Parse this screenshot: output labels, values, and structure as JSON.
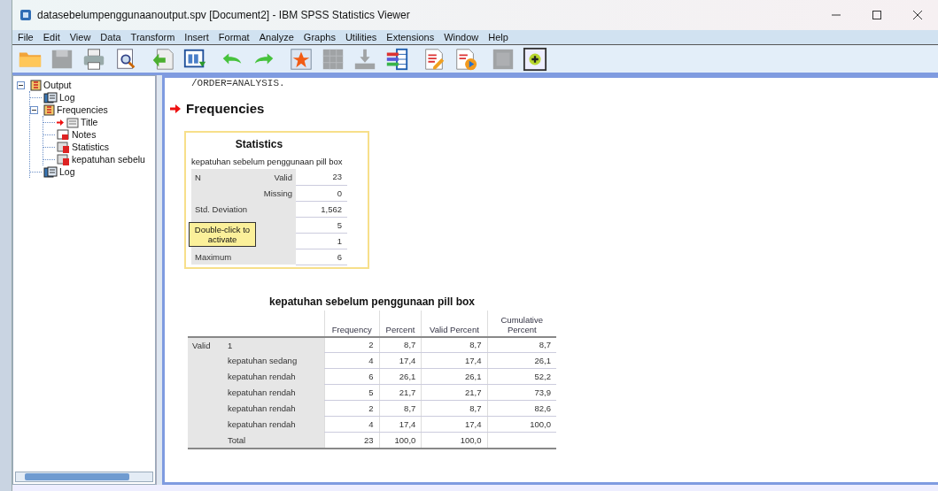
{
  "window": {
    "title": "datasebelumpenggunaanoutput.spv [Document2] - IBM SPSS Statistics Viewer"
  },
  "menu": [
    "File",
    "Edit",
    "View",
    "Data",
    "Transform",
    "Insert",
    "Format",
    "Analyze",
    "Graphs",
    "Utilities",
    "Extensions",
    "Window",
    "Help"
  ],
  "toolbar": [
    {
      "kind": "folder",
      "disabled": false
    },
    {
      "kind": "save",
      "disabled": true
    },
    {
      "kind": "print",
      "disabled": false
    },
    {
      "kind": "preview",
      "disabled": false
    },
    {
      "kind": "export",
      "disabled": false
    },
    {
      "kind": "dialog",
      "disabled": false
    },
    {
      "kind": "undo",
      "disabled": false
    },
    {
      "kind": "redo",
      "disabled": false
    },
    {
      "kind": "star",
      "disabled": false
    },
    {
      "kind": "grid",
      "disabled": true
    },
    {
      "kind": "download",
      "disabled": true
    },
    {
      "kind": "variables",
      "disabled": false
    },
    {
      "kind": "pencil",
      "disabled": false
    },
    {
      "kind": "play",
      "disabled": false
    },
    {
      "kind": "square",
      "disabled": true
    },
    {
      "kind": "plus",
      "disabled": false
    }
  ],
  "outline": [
    {
      "label": "Output",
      "kind": "book",
      "expanded": true,
      "current": false,
      "children": [
        {
          "label": "Log",
          "kind": "log",
          "current": false
        },
        {
          "label": "Frequencies",
          "kind": "book",
          "expanded": true,
          "current": false,
          "children": [
            {
              "label": "Title",
              "kind": "title",
              "current": true
            },
            {
              "label": "Notes",
              "kind": "notes",
              "current": false
            },
            {
              "label": "Statistics",
              "kind": "table",
              "current": false
            },
            {
              "label": "kepatuhan sebelu",
              "kind": "table",
              "current": false
            }
          ]
        },
        {
          "label": "Log",
          "kind": "log",
          "current": false
        }
      ]
    }
  ],
  "viewer": {
    "syntax_tail": "/ORDER=ANALYSIS.",
    "heading": "Frequencies",
    "statistics": {
      "selected": true,
      "title": "Statistics",
      "subtitle": "kepatuhan sebelum penggunaan pill box",
      "rows": [
        {
          "label": "N",
          "sublabel": "Valid",
          "value": "23"
        },
        {
          "label": "",
          "sublabel": "Missing",
          "value": "0"
        },
        {
          "label": "Std. Deviation",
          "sublabel": "",
          "value": "1,562"
        },
        {
          "label": "",
          "sublabel": "",
          "value": "5"
        },
        {
          "label": "",
          "sublabel": "",
          "value": "1"
        },
        {
          "label": "Maximum",
          "sublabel": "",
          "value": "6"
        }
      ],
      "tooltip": "Double-click to activate"
    },
    "frequency_table": {
      "title": "kepatuhan sebelum penggunaan pill box",
      "columns": [
        "Frequency",
        "Percent",
        "Valid Percent",
        "Cumulative Percent"
      ],
      "rows": [
        {
          "group": "Valid",
          "label": "1",
          "cells": [
            "2",
            "8,7",
            "8,7",
            "8,7"
          ]
        },
        {
          "group": "",
          "label": "kepatuhan sedang",
          "cells": [
            "4",
            "17,4",
            "17,4",
            "26,1"
          ]
        },
        {
          "group": "",
          "label": "kepatuhan rendah",
          "cells": [
            "6",
            "26,1",
            "26,1",
            "52,2"
          ]
        },
        {
          "group": "",
          "label": "kepatuhan rendah",
          "cells": [
            "5",
            "21,7",
            "21,7",
            "73,9"
          ]
        },
        {
          "group": "",
          "label": "kepatuhan rendah",
          "cells": [
            "2",
            "8,7",
            "8,7",
            "82,6"
          ]
        },
        {
          "group": "",
          "label": "kepatuhan rendah",
          "cells": [
            "4",
            "17,4",
            "17,4",
            "100,0"
          ]
        },
        {
          "group": "",
          "label": "Total",
          "cells": [
            "23",
            "100,0",
            "100,0",
            ""
          ]
        }
      ]
    }
  }
}
